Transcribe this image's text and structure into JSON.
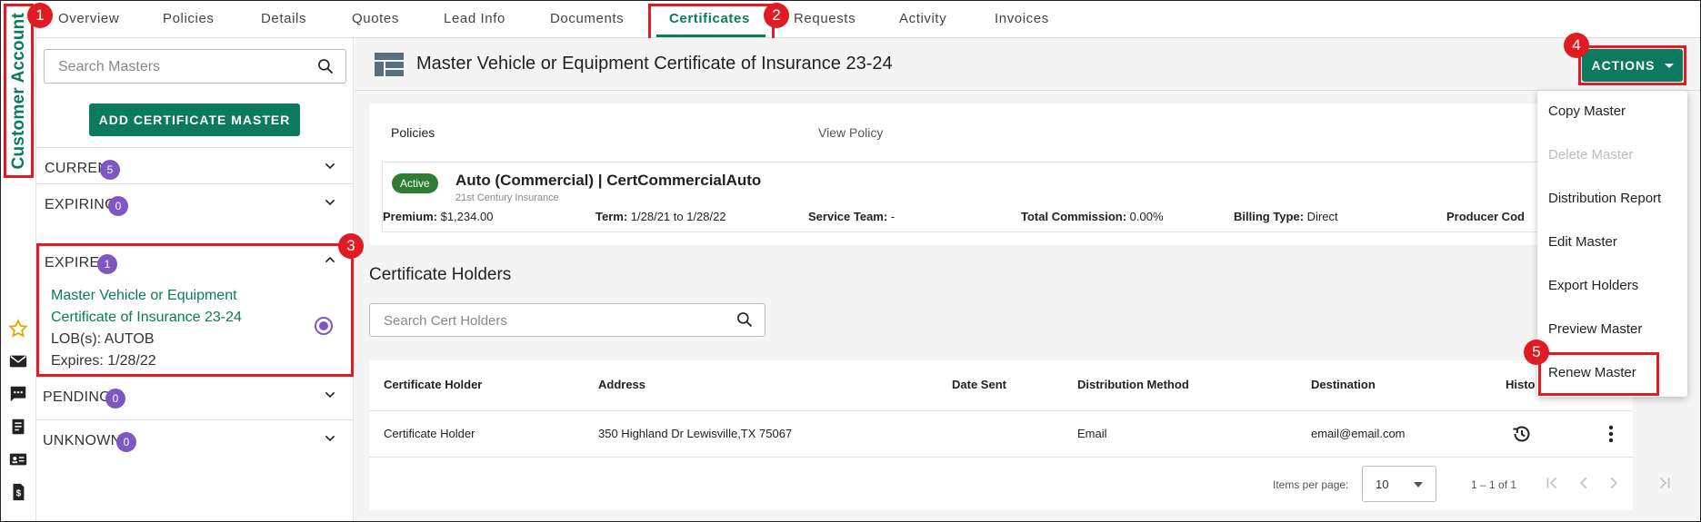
{
  "sidebar_strip": {
    "title": "Customer Account",
    "icons": [
      "star-icon",
      "mail-icon",
      "message-icon",
      "document-icon",
      "id-card-icon",
      "invoice-icon"
    ]
  },
  "tabs": [
    "Overview",
    "Policies",
    "Details",
    "Quotes",
    "Lead Info",
    "Documents",
    "Certificates",
    "Requests",
    "Activity",
    "Invoices"
  ],
  "active_tab": "Certificates",
  "callouts": [
    "1",
    "2",
    "3",
    "4",
    "5"
  ],
  "left_panel": {
    "search_placeholder": "Search Masters",
    "add_button": "ADD CERTIFICATE MASTER",
    "segments": [
      {
        "label": "CURRENT",
        "count": "5",
        "expanded": false
      },
      {
        "label": "EXPIRING",
        "count": "0",
        "expanded": false
      },
      {
        "label": "EXPIRED",
        "count": "1",
        "expanded": true
      },
      {
        "label": "PENDING",
        "count": "0",
        "expanded": false
      },
      {
        "label": "UNKNOWN",
        "count": "0",
        "expanded": false
      }
    ],
    "expired_item": {
      "title_line1": "Master Vehicle or Equipment",
      "title_line2": "Certificate of Insurance 23-24",
      "lob": "LOB(s): AUTOB",
      "expires": "Expires: 1/28/22"
    }
  },
  "main": {
    "title": "Master Vehicle or Equipment Certificate of Insurance 23-24",
    "actions_label": "ACTIONS",
    "policies": {
      "header": "Policies",
      "view_policy": "View Policy",
      "status": "Active",
      "policy_title": "Auto (Commercial) | CertCommercialAuto",
      "carrier": "21st Century Insurance",
      "fields": [
        {
          "label": "Premium:",
          "value": "$1,234.00"
        },
        {
          "label": "Term:",
          "value": "1/28/21 to 1/28/22"
        },
        {
          "label": "Service Team:",
          "value": "-"
        },
        {
          "label": "Total Commission:",
          "value": "0.00%"
        },
        {
          "label": "Billing Type:",
          "value": "Direct"
        },
        {
          "label": "Producer Cod",
          "value": ""
        }
      ]
    },
    "cert_holders": {
      "title": "Certificate Holders",
      "search_placeholder": "Search Cert Holders",
      "columns": [
        "Certificate Holder",
        "Address",
        "Date Sent",
        "Distribution Method",
        "Destination",
        "Histo"
      ],
      "rows": [
        {
          "holder": "Certificate Holder",
          "address": "350 Highland Dr Lewisville,TX 75067",
          "date_sent": "",
          "method": "Email",
          "destination": "email@email.com"
        }
      ],
      "items_per_page_label": "Items per page:",
      "items_per_page": "10",
      "range": "1 – 1 of 1"
    }
  },
  "actions_menu": [
    {
      "label": "Copy Master",
      "disabled": false
    },
    {
      "label": "Delete Master",
      "disabled": true
    },
    {
      "label": "Distribution Report",
      "disabled": false
    },
    {
      "label": "Edit Master",
      "disabled": false
    },
    {
      "label": "Export Holders",
      "disabled": false
    },
    {
      "label": "Preview Master",
      "disabled": false
    },
    {
      "label": "Renew Master",
      "disabled": false
    }
  ],
  "colors": {
    "accent": "#0b7a5e",
    "callout": "#e01b24",
    "badge": "#7e57c2",
    "active": "#2e7d32"
  }
}
